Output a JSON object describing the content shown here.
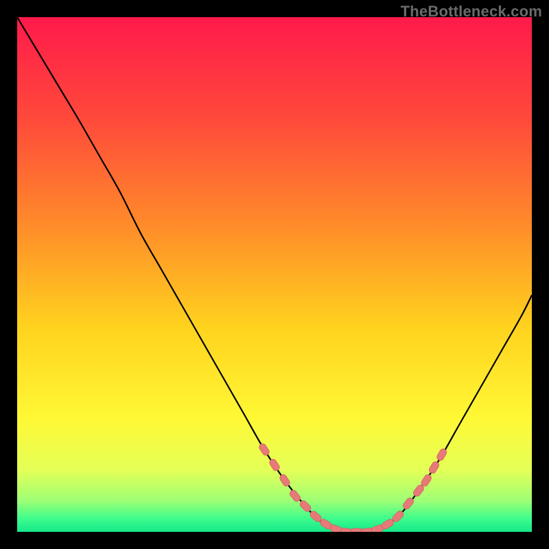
{
  "watermark": "TheBottleneck.com",
  "colors": {
    "background": "#000000",
    "curve_stroke": "#000000",
    "marker_fill": "#e77a79",
    "marker_stroke": "#cf6160"
  },
  "chart_data": {
    "type": "line",
    "title": "",
    "xlabel": "",
    "ylabel": "",
    "xlim": [
      0,
      100
    ],
    "ylim": [
      0,
      100
    ],
    "gradient_stops": [
      {
        "offset": 0.0,
        "color": "#ff1a4b"
      },
      {
        "offset": 0.2,
        "color": "#ff4a3a"
      },
      {
        "offset": 0.4,
        "color": "#ff8a2a"
      },
      {
        "offset": 0.6,
        "color": "#ffd21e"
      },
      {
        "offset": 0.78,
        "color": "#fff835"
      },
      {
        "offset": 0.88,
        "color": "#e4ff57"
      },
      {
        "offset": 0.94,
        "color": "#9dff75"
      },
      {
        "offset": 0.975,
        "color": "#3cfc8c"
      },
      {
        "offset": 1.0,
        "color": "#15e88a"
      }
    ],
    "series": [
      {
        "name": "bottleneck-curve",
        "x": [
          0.0,
          3.0,
          6.0,
          9.0,
          12.0,
          16.0,
          20.0,
          24.0,
          28.0,
          32.0,
          36.0,
          40.0,
          44.0,
          48.0,
          52.0,
          56.0,
          59.0,
          62.0,
          66.0,
          70.0,
          74.0,
          78.0,
          82.0,
          86.0,
          90.0,
          94.0,
          98.0,
          100.0
        ],
        "y": [
          100.0,
          95.0,
          90.0,
          85.0,
          80.0,
          73.0,
          66.0,
          58.0,
          51.0,
          44.0,
          37.0,
          30.0,
          23.0,
          16.0,
          10.0,
          5.0,
          2.0,
          0.5,
          0.0,
          0.5,
          3.0,
          8.0,
          14.0,
          21.0,
          28.0,
          35.0,
          42.0,
          46.0
        ]
      }
    ],
    "markers": {
      "name": "highlighted-points",
      "points": [
        {
          "x": 48.0,
          "y": 16.0
        },
        {
          "x": 50.0,
          "y": 13.0
        },
        {
          "x": 52.0,
          "y": 10.0
        },
        {
          "x": 54.0,
          "y": 7.0
        },
        {
          "x": 56.0,
          "y": 5.0
        },
        {
          "x": 58.0,
          "y": 3.0
        },
        {
          "x": 60.0,
          "y": 1.5
        },
        {
          "x": 62.0,
          "y": 0.5
        },
        {
          "x": 64.0,
          "y": 0.0
        },
        {
          "x": 66.0,
          "y": 0.0
        },
        {
          "x": 68.0,
          "y": 0.0
        },
        {
          "x": 70.0,
          "y": 0.5
        },
        {
          "x": 72.0,
          "y": 1.5
        },
        {
          "x": 74.0,
          "y": 3.0
        },
        {
          "x": 76.0,
          "y": 5.5
        },
        {
          "x": 78.0,
          "y": 8.0
        },
        {
          "x": 79.5,
          "y": 10.0
        },
        {
          "x": 81.0,
          "y": 12.5
        },
        {
          "x": 82.5,
          "y": 15.0
        }
      ]
    }
  }
}
